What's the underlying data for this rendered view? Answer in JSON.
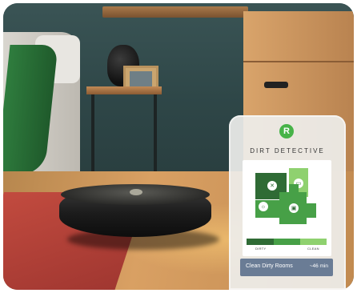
{
  "app": {
    "title": "DIRT DETECTIVE",
    "logo": "R"
  },
  "map": {
    "rooms": [
      {
        "name": "kitchen",
        "level": "dirty",
        "icon": "utensils-icon"
      },
      {
        "name": "bathroom",
        "level": "clean",
        "icon": "toilet-icon"
      },
      {
        "name": "living",
        "level": "medium",
        "icon": "sofa-icon"
      },
      {
        "name": "office",
        "level": "medium",
        "icon": "lamp-icon"
      }
    ],
    "legend": {
      "dirty": "DIRTY",
      "clean": "CLEAN"
    }
  },
  "action": {
    "label": "Clean Dirty Rooms",
    "time": "~46 min"
  },
  "colors": {
    "dirty": "#2f6b35",
    "medium": "#47a047",
    "clean": "#8fd16f",
    "button": "#6a7c95"
  }
}
